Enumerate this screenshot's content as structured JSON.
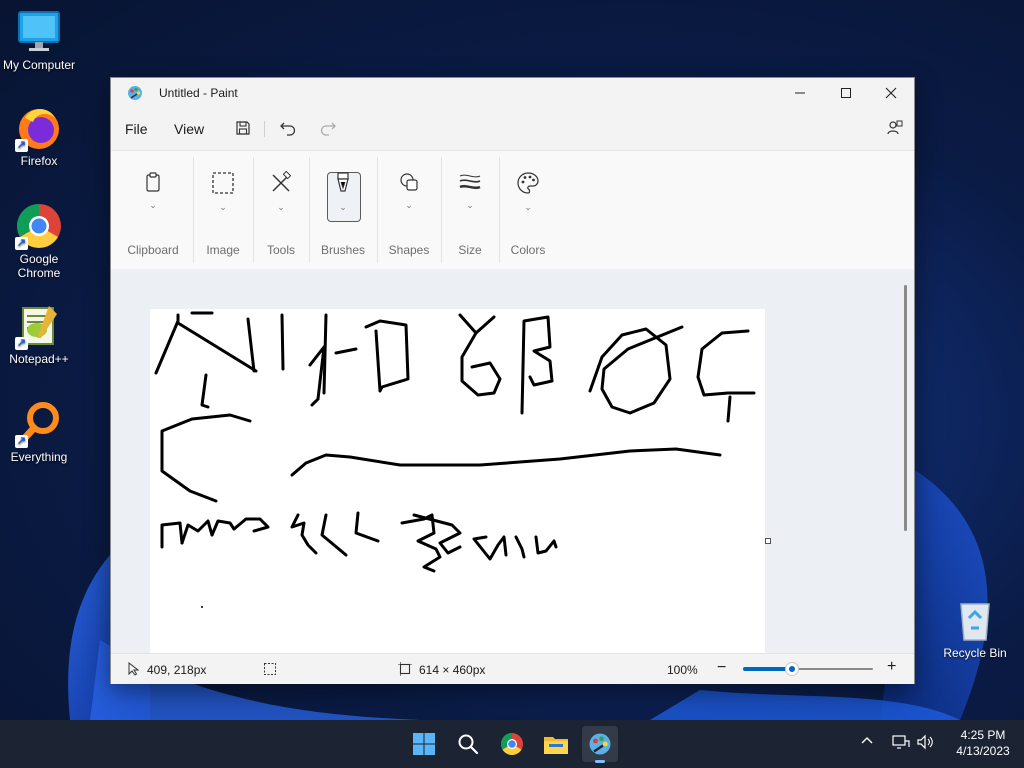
{
  "desktop": {
    "icons": [
      {
        "label": "My Computer"
      },
      {
        "label": "Firefox"
      },
      {
        "label": "Google Chrome"
      },
      {
        "label": "Notepad++"
      },
      {
        "label": "Everything"
      },
      {
        "label": "Recycle Bin"
      }
    ]
  },
  "window": {
    "title": "Untitled - Paint",
    "menu": {
      "file": "File",
      "view": "View"
    },
    "ribbon": {
      "groups": [
        {
          "label": "Clipboard",
          "icon": "clipboard-icon"
        },
        {
          "label": "Image",
          "icon": "selection-icon"
        },
        {
          "label": "Tools",
          "icon": "tools-icon"
        },
        {
          "label": "Brushes",
          "icon": "brush-icon",
          "selected": true
        },
        {
          "label": "Shapes",
          "icon": "shapes-icon"
        },
        {
          "label": "Size",
          "icon": "size-icon"
        },
        {
          "label": "Colors",
          "icon": "palette-icon"
        }
      ]
    },
    "status": {
      "cursor_position": "409, 218px",
      "canvas_size": "614 × 460px",
      "zoom": "100%",
      "zoom_slider_fraction": 0.38
    }
  },
  "taskbar": {
    "time": "4:25 PM",
    "date": "4/13/2023"
  },
  "colors": {
    "accent": "#0067c0"
  }
}
